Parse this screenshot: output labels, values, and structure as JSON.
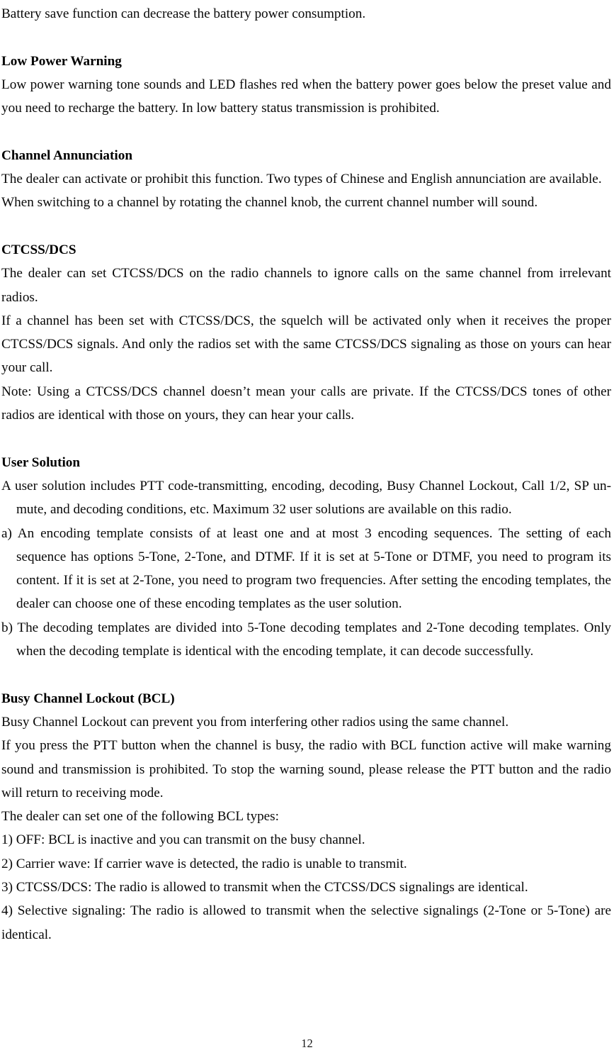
{
  "document": {
    "page_number": "12",
    "blocks": [
      {
        "id": "battery-save-line",
        "type": "paragraph",
        "text": "Battery save function can decrease the battery power consumption."
      },
      {
        "id": "low-power-warning-heading",
        "type": "heading",
        "text": "Low Power Warning"
      },
      {
        "id": "low-power-warning-body",
        "type": "paragraph",
        "text": "Low power warning tone sounds and LED flashes red when the battery power goes below the preset value and you need to recharge the battery. In low battery status transmission is prohibited."
      },
      {
        "id": "channel-annunciation-heading",
        "type": "heading",
        "text": "Channel Annunciation"
      },
      {
        "id": "channel-annunciation-body-1",
        "type": "paragraph",
        "text": "The dealer can activate or prohibit this function. Two types of Chinese and English annunciation are available."
      },
      {
        "id": "channel-annunciation-body-2",
        "type": "paragraph",
        "text": "When switching to a channel by rotating the channel knob, the current channel number will sound."
      },
      {
        "id": "ctcss-dcs-heading",
        "type": "heading",
        "text": "CTCSS/DCS"
      },
      {
        "id": "ctcss-dcs-body-1",
        "type": "paragraph",
        "text": "The dealer can set CTCSS/DCS on the radio channels to ignore calls on the same channel from irrelevant radios."
      },
      {
        "id": "ctcss-dcs-body-2",
        "type": "paragraph",
        "text": "If a channel has been set with CTCSS/DCS, the squelch will be activated only when it receives the proper CTCSS/DCS signals. And only the radios set with the same CTCSS/DCS signaling as those on yours can hear your call."
      },
      {
        "id": "ctcss-dcs-note",
        "type": "paragraph",
        "text": "Note: Using a CTCSS/DCS channel doesn’t mean your calls are private. If the CTCSS/DCS tones of other radios are identical with those on yours, they can hear your calls."
      },
      {
        "id": "user-solution-heading",
        "type": "heading",
        "text": "User Solution"
      },
      {
        "id": "user-solution-intro",
        "type": "paragraph-continuation-indent",
        "text": "A user solution includes PTT code-transmitting, encoding, decoding, Busy Channel Lockout, Call 1/2, SP un-mute, and decoding conditions, etc. Maximum 32 user solutions are available on this radio."
      },
      {
        "id": "user-solution-item-a",
        "type": "list-item-hanging",
        "text": "a) An encoding template consists of at least one and at most 3 encoding sequences. The setting of each sequence has options 5-Tone, 2-Tone, and DTMF. If it is set at 5-Tone or DTMF, you need to program its content. If it is set at 2-Tone, you need to program two frequencies. After setting the encoding templates, the dealer can choose one of these encoding templates as the user solution."
      },
      {
        "id": "user-solution-item-b",
        "type": "list-item-hanging",
        "text": "b) The decoding templates are divided into 5-Tone decoding templates and 2-Tone decoding templates. Only when the decoding template is identical with the encoding template, it can decode successfully."
      },
      {
        "id": "bcl-heading",
        "type": "heading",
        "text": "Busy Channel Lockout (BCL)"
      },
      {
        "id": "bcl-body-1",
        "type": "paragraph",
        "text": "Busy Channel Lockout can prevent you from interfering other radios using the same channel."
      },
      {
        "id": "bcl-body-2",
        "type": "paragraph",
        "text": "If you press the PTT button when the channel is busy, the radio with BCL function active will make warning sound and transmission is prohibited. To stop the warning sound, please release the PTT button and the radio will return to receiving mode."
      },
      {
        "id": "bcl-types-intro",
        "type": "paragraph",
        "text": "The dealer can set one of the following BCL types:"
      },
      {
        "id": "bcl-type-1",
        "type": "list-item-flat",
        "text": "1) OFF: BCL is inactive and you can transmit on the busy channel."
      },
      {
        "id": "bcl-type-2",
        "type": "list-item-flat",
        "text": "2) Carrier wave: If carrier wave is detected, the radio is unable to transmit."
      },
      {
        "id": "bcl-type-3",
        "type": "list-item-flat",
        "text": "3) CTCSS/DCS: The radio is allowed to transmit when the CTCSS/DCS signalings are identical."
      },
      {
        "id": "bcl-type-4",
        "type": "paragraph",
        "text": "4) Selective signaling: The radio is allowed to transmit when the selective signalings (2-Tone or 5-Tone) are identical."
      }
    ]
  }
}
